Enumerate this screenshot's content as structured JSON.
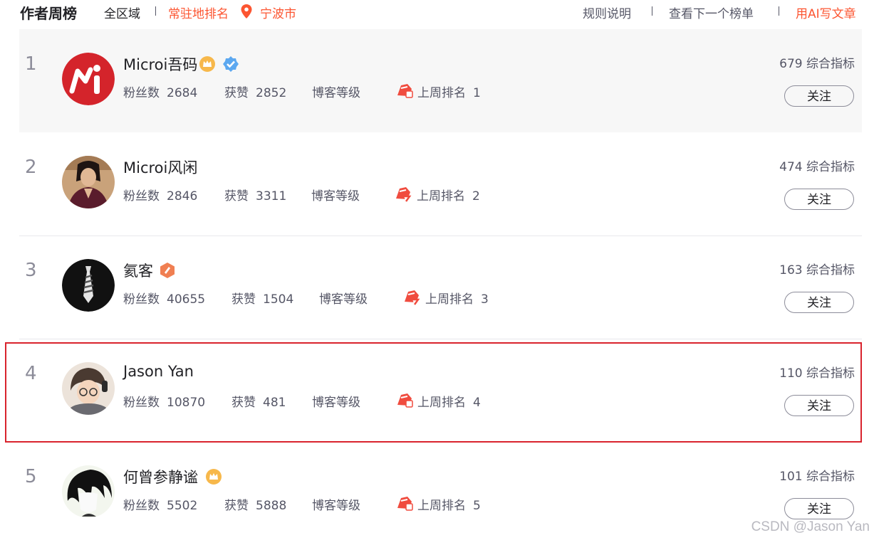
{
  "header": {
    "title": "作者周榜",
    "all_region": "全区域",
    "resident_ranking": "常驻地排名",
    "city": "宁波市",
    "rules": "规则说明",
    "next_list": "查看下一个榜单",
    "ai_write": "用AI写文章"
  },
  "labels": {
    "fans": "粉丝数",
    "likes": "获赞",
    "level": "博客等级",
    "last_week": "上周排名",
    "follow": "关注"
  },
  "authors": [
    {
      "rank": "1",
      "name": "Microi吾码",
      "fans": "2684",
      "likes": "2852",
      "last_week_rank": "1",
      "score": "679 综合指标"
    },
    {
      "rank": "2",
      "name": "Microi风闲",
      "fans": "2846",
      "likes": "3311",
      "last_week_rank": "2",
      "score": "474 综合指标"
    },
    {
      "rank": "3",
      "name": "氦客",
      "fans": "40655",
      "likes": "1504",
      "last_week_rank": "3",
      "score": "163 综合指标"
    },
    {
      "rank": "4",
      "name": "Jason Yan",
      "fans": "10870",
      "likes": "481",
      "last_week_rank": "4",
      "score": "110 综合指标"
    },
    {
      "rank": "5",
      "name": "何曾参静谧",
      "fans": "5502",
      "likes": "5888",
      "last_week_rank": "5",
      "score": "101 综合指标"
    }
  ],
  "watermark": "CSDN @Jason Yan",
  "colors": {
    "accent": "#fc5531",
    "highlight_border": "#d9232d"
  },
  "icons": [
    "location-pin-icon",
    "crown-badge-icon",
    "verified-badge-icon",
    "expert-badge-icon",
    "blog-level-icon"
  ]
}
